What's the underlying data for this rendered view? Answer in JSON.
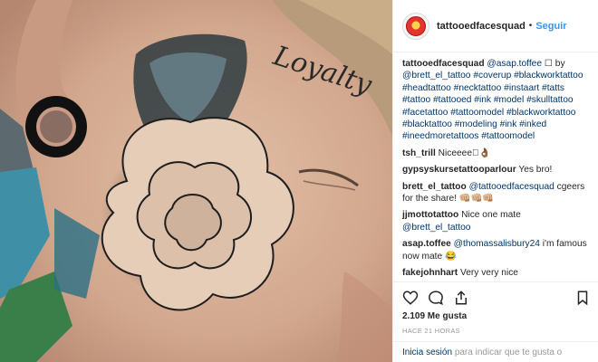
{
  "header": {
    "username": "tattooedfacesquad",
    "separator": "•",
    "follow_label": "Seguir"
  },
  "caption": {
    "username": "tattooedfacesquad",
    "mention1": "@asap.toffee",
    "by_text": "☐ by",
    "mention2": "@brett_el_tattoo",
    "hashtags": "#coverup #blackworktattoo #headtattoo #necktattoo #instaart #tatts #tattoo #tattooed #ink #model #skulltattoo #facetattoo #tattoomodel #blackworktattoo #blacktattoo #modeling #ink #inked #ineedmoretattoos #tattoomodel"
  },
  "comments": [
    {
      "username": "tsh_trill",
      "text": "Niceeee🏾👌🏾"
    },
    {
      "username": "gypsyskursetattooparlour",
      "text": "Yes bro!"
    },
    {
      "username": "brett_el_tattoo",
      "mention": "@tattooedfacesquad",
      "text": "cgeers for the share! 👊🏼👊🏼👊🏼"
    },
    {
      "username": "jjmottotattoo",
      "text": "Nice one mate",
      "mention": "@brett_el_tattoo"
    },
    {
      "username": "asap.toffee",
      "mention": "@thomassalisbury24",
      "text": "i'm famous now mate 😂"
    },
    {
      "username": "fakejohnhart",
      "text": "Very very nice"
    }
  ],
  "actions": {
    "icons": [
      "heart-icon",
      "comment-icon",
      "share-icon",
      "bookmark-icon"
    ]
  },
  "likes_label": "2.109 Me gusta",
  "time_label": "HACE 21 HORAS",
  "login": {
    "link": "Inicia sesión",
    "text": "para indicar que te gusta o"
  },
  "photo": {
    "face_tattoo_text": "Loyalty"
  }
}
